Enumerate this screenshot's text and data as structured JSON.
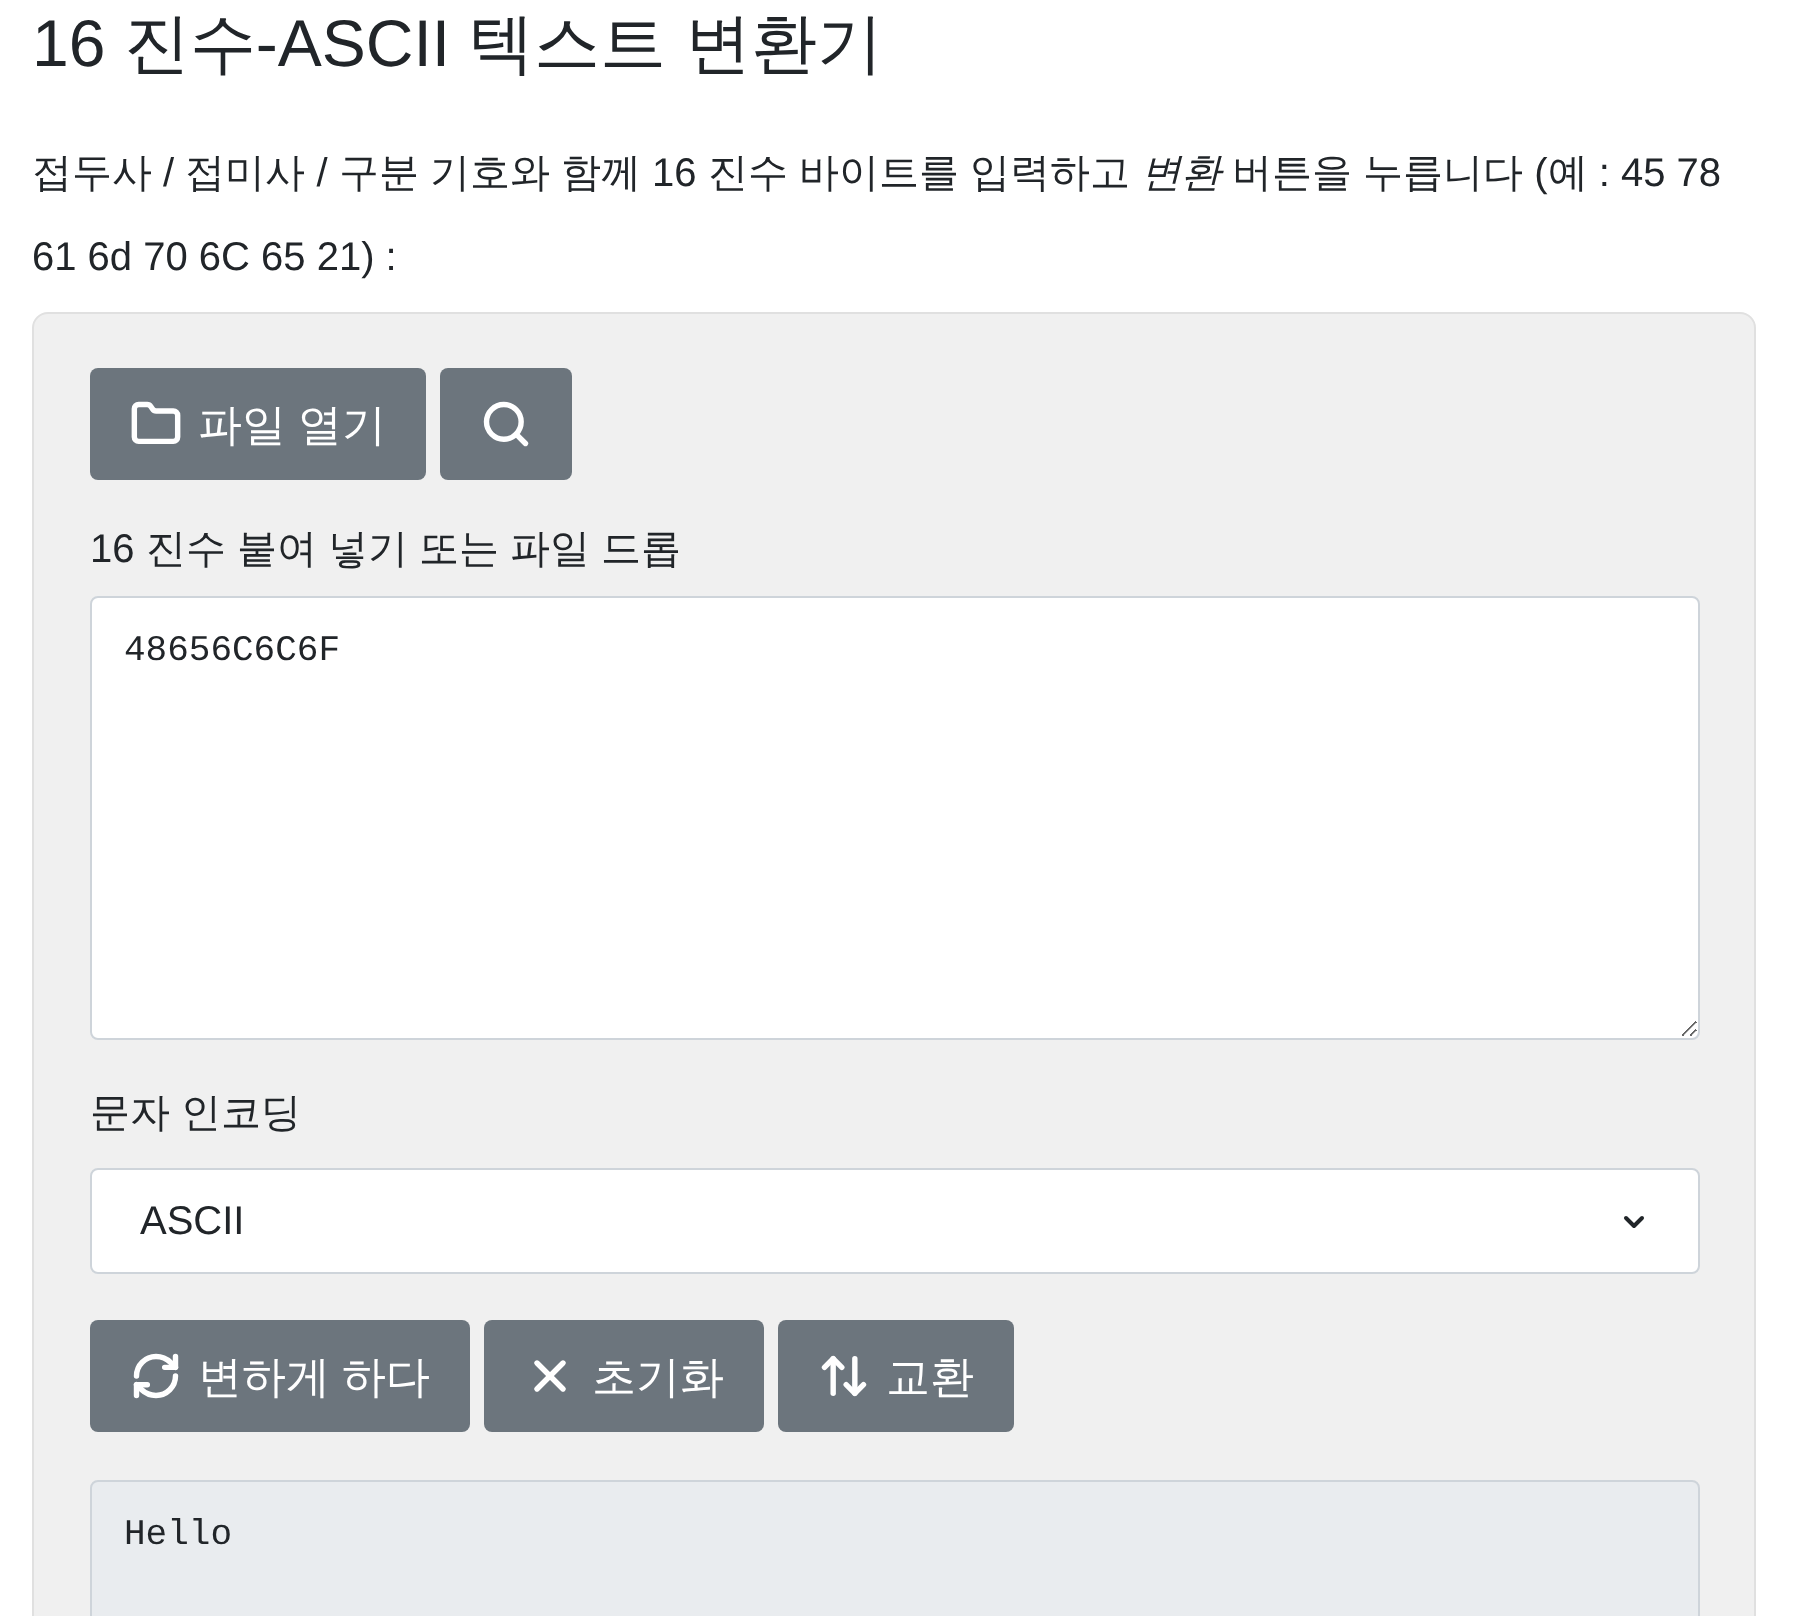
{
  "title": "16 진수-ASCII 텍스트 변환기",
  "intro": "접두사 / 접미사 / 구분 기호와 함께 16 진수 바이트를 입력하고 *변환* 버튼을 누릅니다 (예 : 45 78 61 6d 70 6C 65 21) :",
  "file_buttons": [
    {
      "kind": "folder",
      "label": "파일 열기"
    },
    {
      "kind": "search"
    }
  ],
  "input": {
    "label": "16 진수 붙여 넣기 또는 파일 드롭",
    "value": "48656C6C6F"
  },
  "encoding": {
    "label": "문자 인코딩",
    "value": "ASCII"
  },
  "action_buttons": [
    {
      "kind": "convert",
      "label": "변하게 하다"
    },
    {
      "kind": "reset",
      "label": "초기화"
    },
    {
      "kind": "swap",
      "label": "교환"
    }
  ],
  "output": {
    "value": "Hello"
  }
}
